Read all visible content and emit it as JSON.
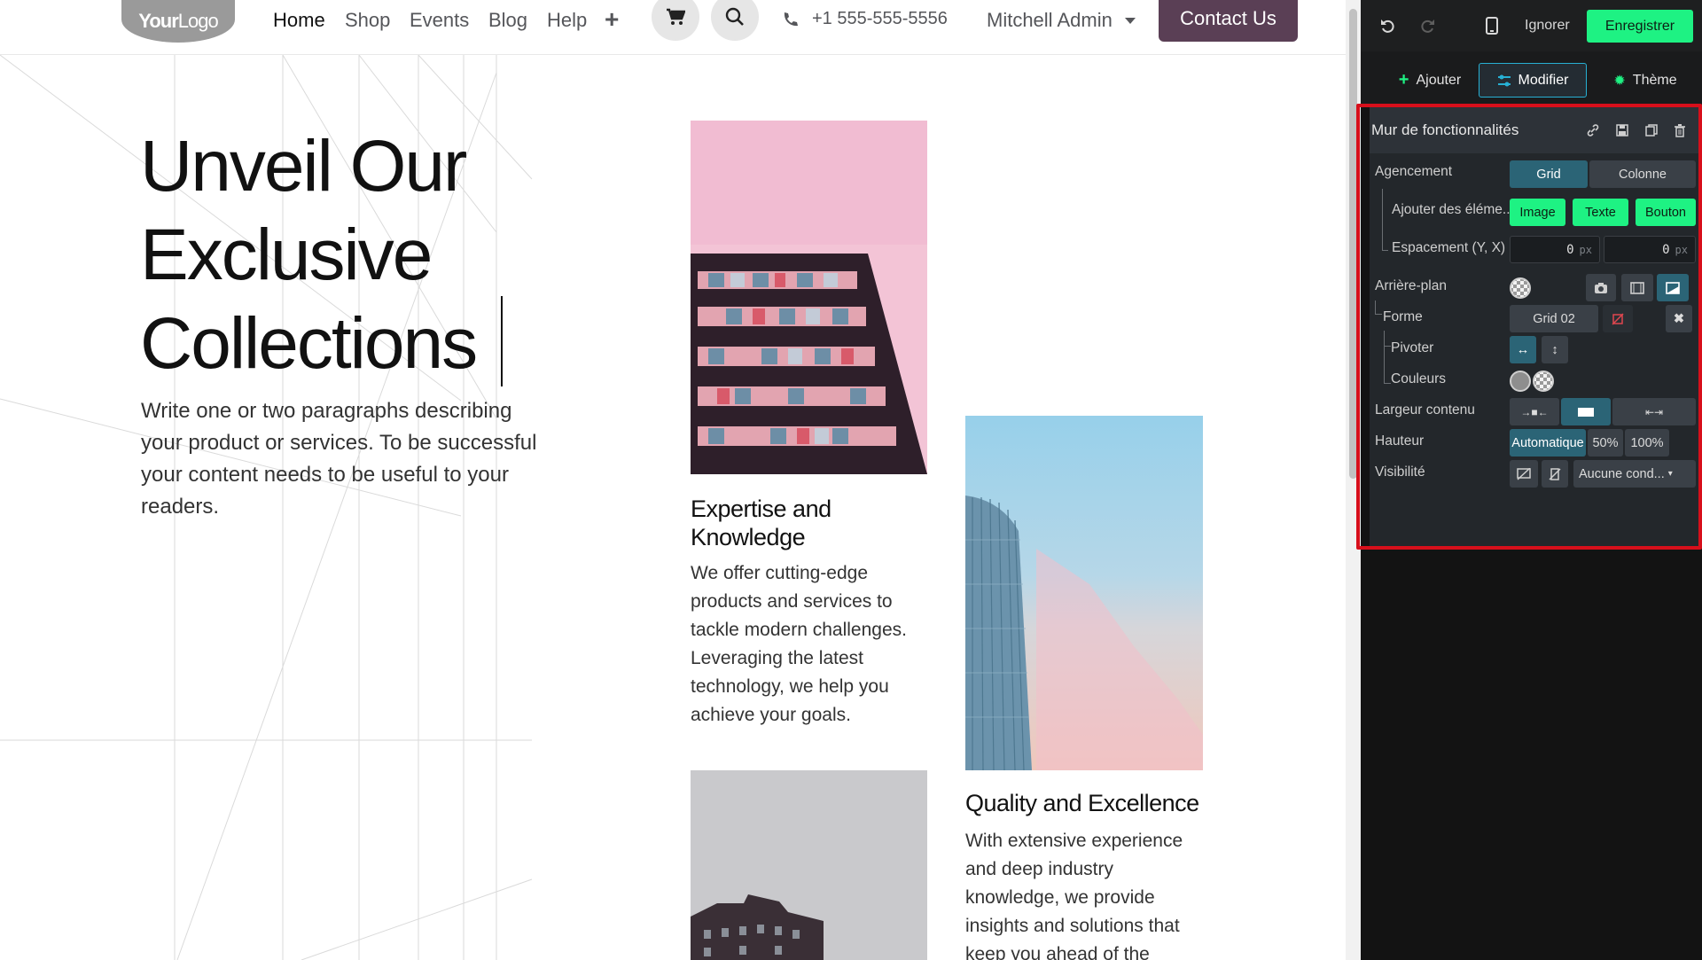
{
  "site": {
    "logo": {
      "bold": "Your",
      "regular": "Logo"
    },
    "nav": {
      "items": [
        "Home",
        "Shop",
        "Events",
        "Blog",
        "Help"
      ],
      "active": "Home",
      "plus": "+",
      "phone": "+1 555-555-5556",
      "admin": "Mitchell Admin",
      "contact": "Contact Us"
    },
    "hero": {
      "title": "Unveil Our Exclusive Collections",
      "text": "Write one or two paragraphs describing your product or services. To be successful your content needs to be useful to your readers."
    },
    "cards": [
      {
        "title": "Expertise and Knowledge",
        "text": "We offer cutting-edge products and services to tackle modern challenges. Leveraging the latest technology, we help you achieve your goals."
      },
      {
        "title": "Quality and Excellence",
        "text": "With extensive experience and deep industry knowledge, we provide insights and solutions that keep you ahead of the"
      }
    ]
  },
  "editor": {
    "topbar": {
      "ignore": "Ignorer",
      "save": "Enregistrer"
    },
    "tabs": {
      "add": "Ajouter",
      "edit": "Modifier",
      "theme": "Thème"
    },
    "block": {
      "title": "Mur de fonctionnalités",
      "layout": {
        "label": "Agencement",
        "grid": "Grid",
        "column": "Colonne"
      },
      "add_elements": {
        "label": "Ajouter des éléme...",
        "image": "Image",
        "text": "Texte",
        "button": "Bouton"
      },
      "spacing": {
        "label": "Espacement (Y, X)",
        "y": "0",
        "x": "0",
        "unit": "px"
      },
      "background": {
        "label": "Arrière-plan"
      },
      "shape": {
        "label": "Forme",
        "value": "Grid 02"
      },
      "rotate": {
        "label": "Pivoter"
      },
      "colors": {
        "label": "Couleurs"
      },
      "content_width": {
        "label": "Largeur contenu"
      },
      "height": {
        "label": "Hauteur",
        "auto": "Automatique",
        "half": "50%",
        "full": "100%"
      },
      "visibility": {
        "label": "Visibilité",
        "condition": "Aucune cond..."
      }
    }
  },
  "colors": {
    "accent_green": "#1ef283",
    "accent_blue": "#2b6476",
    "contact_button": "#5a3f55",
    "highlight_red": "#d70f1b"
  }
}
